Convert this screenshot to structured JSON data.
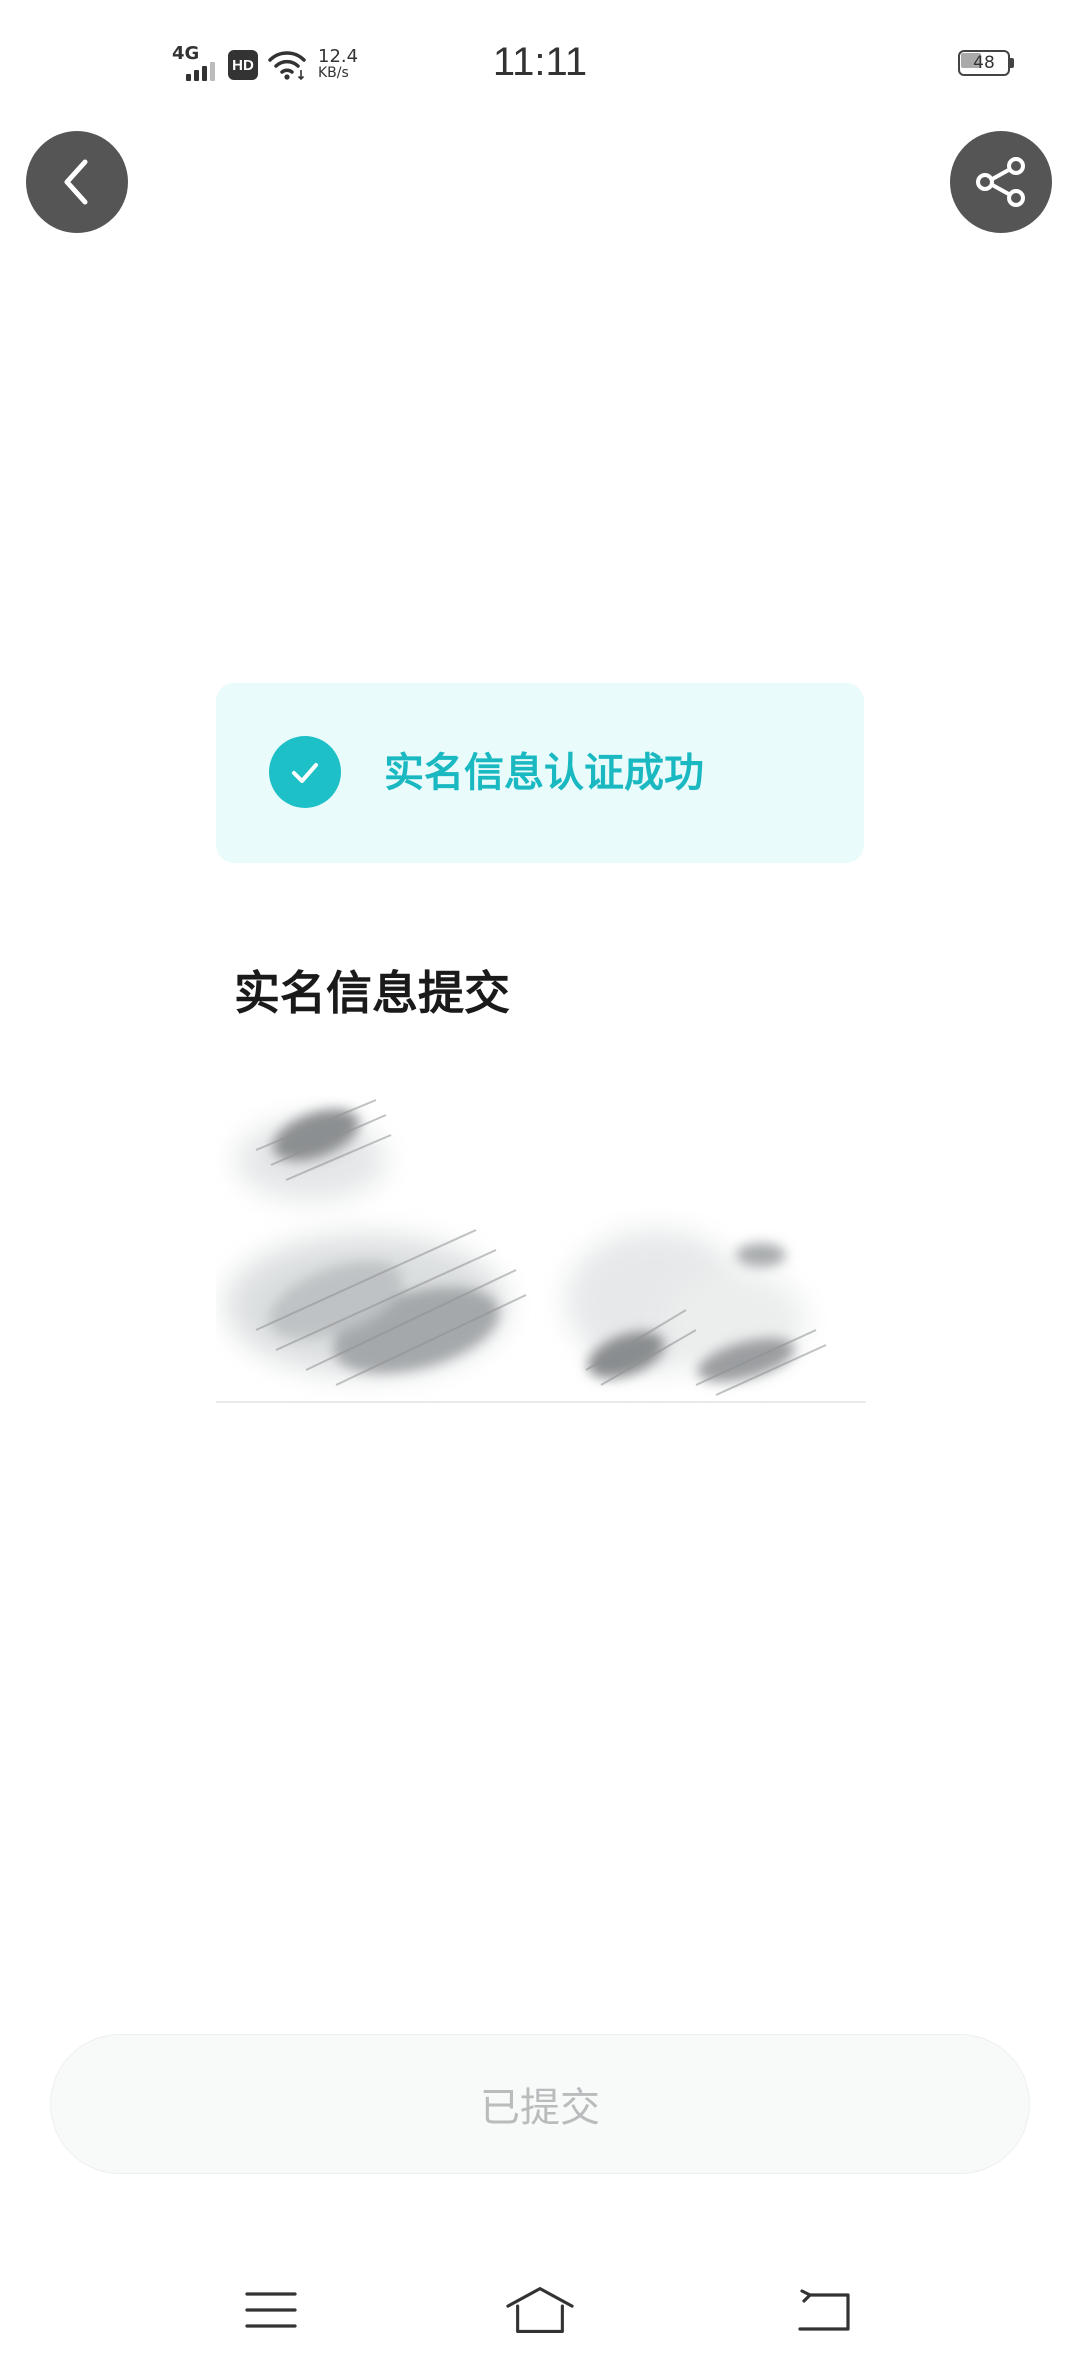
{
  "status_bar": {
    "network": "4G",
    "hd": "HD",
    "speed_value": "12.4",
    "speed_unit": "KB/s",
    "time": "11:11",
    "battery": "48",
    "battery_level_percent": 48
  },
  "header": {
    "back_icon": "chevron-left-icon",
    "share_icon": "share-icon"
  },
  "success_banner": {
    "icon": "check-circle-icon",
    "text": "实名信息认证成功"
  },
  "section": {
    "title": "实名信息提交"
  },
  "submit_button": {
    "label": "已提交"
  },
  "nav_bar": {
    "icons": [
      "menu-icon",
      "home-icon",
      "back-icon"
    ]
  },
  "colors": {
    "accent": "#1ec0c7",
    "banner_bg": "#eafbfb",
    "header_button_bg": "#555555",
    "disabled_text": "#b9bcbc"
  }
}
